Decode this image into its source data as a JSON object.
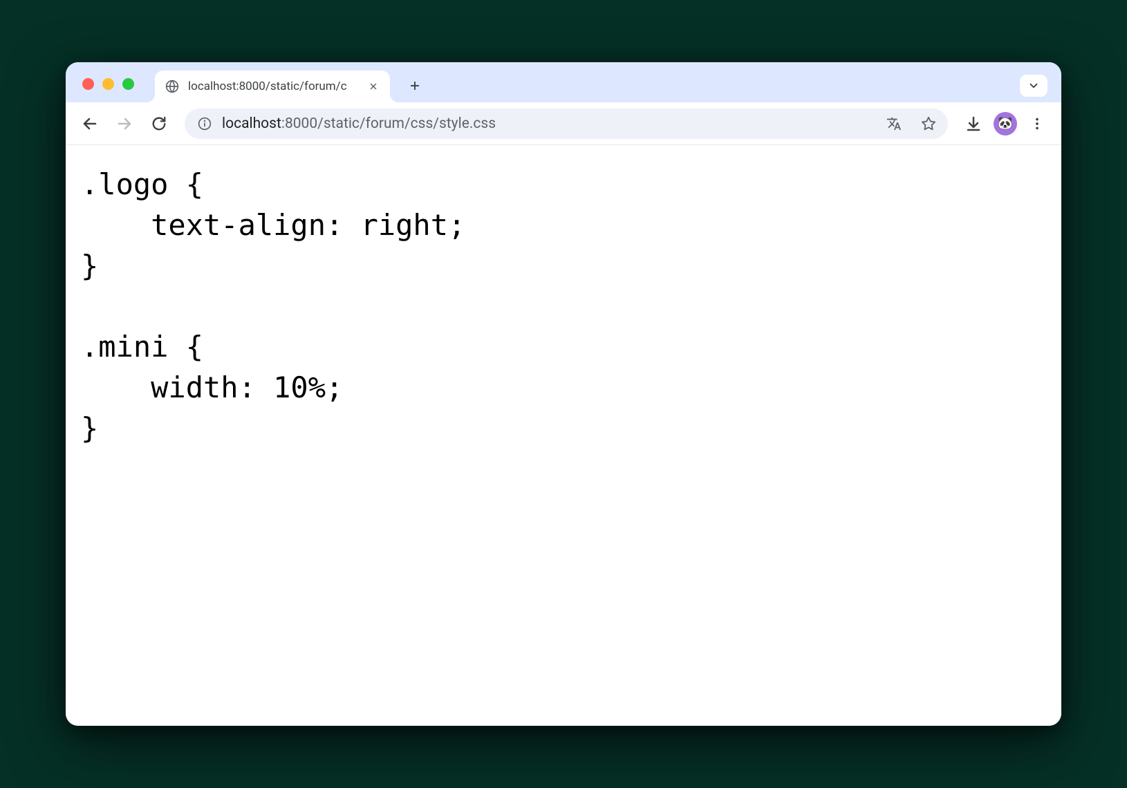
{
  "tab": {
    "title": "localhost:8000/static/forum/c"
  },
  "url": {
    "host": "localhost",
    "port_path": ":8000/static/forum/css/style.css"
  },
  "avatar_emoji": "🐼",
  "content": ".logo {\n    text-align: right;\n}\n\n.mini {\n    width: 10%;\n}"
}
